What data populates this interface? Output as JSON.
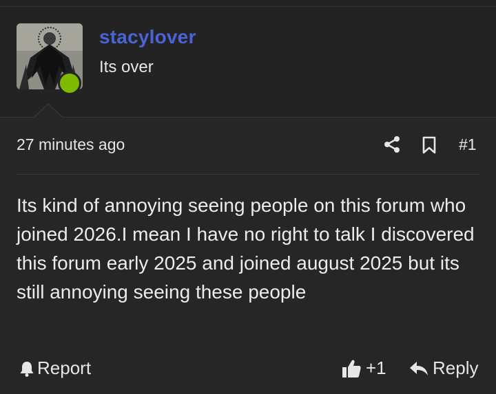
{
  "user": {
    "username": "stacylover",
    "title": "Its over",
    "online": true,
    "username_color": "#4a63d6",
    "status_color": "#7fba00"
  },
  "post": {
    "time": "27 minutes ago",
    "number": "#1",
    "body": "Its kind of annoying seeing people on this forum who joined 2026.I mean I have no right to talk I discovered this forum early 2025 and joined august 2025 but its still annoying seeing these people"
  },
  "actions": {
    "report_label": "Report",
    "like_count": "+1",
    "reply_label": "Reply"
  },
  "icons": {
    "share": "share-icon",
    "bookmark": "bookmark-icon",
    "report": "bell-icon",
    "like": "thumbs-up-icon",
    "reply": "reply-arrow-icon"
  }
}
